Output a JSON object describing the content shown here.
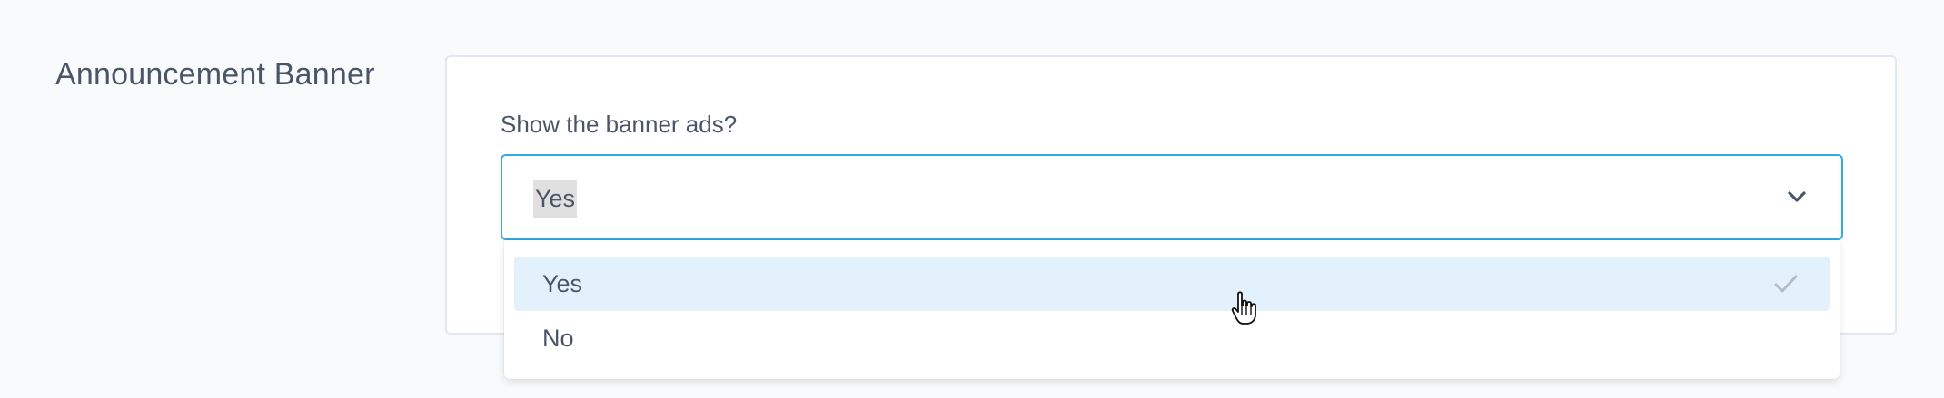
{
  "section": {
    "title": "Announcement Banner"
  },
  "field": {
    "label": "Show the banner ads?",
    "selected_value": "Yes",
    "dropdown_icon": "chevron-down-icon"
  },
  "dropdown": {
    "options": [
      {
        "label": "Yes",
        "selected": true,
        "icon": "check-icon"
      },
      {
        "label": "No",
        "selected": false
      }
    ]
  },
  "cursor": {
    "icon": "hand-pointer-icon"
  },
  "colors": {
    "focus_border": "#36a8e6",
    "selected_option_bg": "#e3f1fc",
    "text": "#4a5568",
    "page_bg": "#f8fafc"
  }
}
